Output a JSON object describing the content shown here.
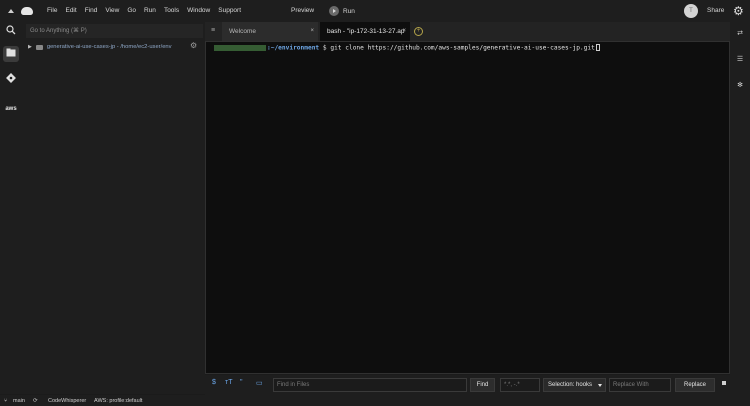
{
  "menubar": {
    "items": [
      "File",
      "Edit",
      "Find",
      "View",
      "Go",
      "Run",
      "Tools",
      "Window",
      "Support"
    ],
    "preview_label": "Preview",
    "run_label": "Run",
    "avatar_initial": "T",
    "share_label": "Share"
  },
  "filepanel": {
    "goto_placeholder": "Go to Anything (⌘ P)",
    "tree_item_label": "generative-ai-use-cases-jp - /home/ec2-user/env"
  },
  "tabs": [
    {
      "label": "Welcome",
      "active": false
    },
    {
      "label": "bash - \"ip-172-31-13-27.ap",
      "active": true
    }
  ],
  "terminal": {
    "path": ":~/environment",
    "prompt": " $ ",
    "command": "git clone https://github.com/aws-samples/generative-ai-use-cases-jp.git"
  },
  "findbar": {
    "find_in_files_placeholder": "Find in Files",
    "find_label": "Find",
    "pattern_placeholder": "*.*, -.*",
    "selection_label": "Selection: hooks",
    "replace_with_placeholder": "Replace With",
    "replace_label": "Replace"
  },
  "statusbar": {
    "branch": "main",
    "codewhisperer": "CodeWhisperer",
    "aws_profile": "AWS: profile:default"
  },
  "colors": {
    "background": "#1b1b1b",
    "terminal_bg": "#0e0e0e",
    "path_color": "#6ea7e6",
    "accent_blue": "#6ba6e8"
  }
}
